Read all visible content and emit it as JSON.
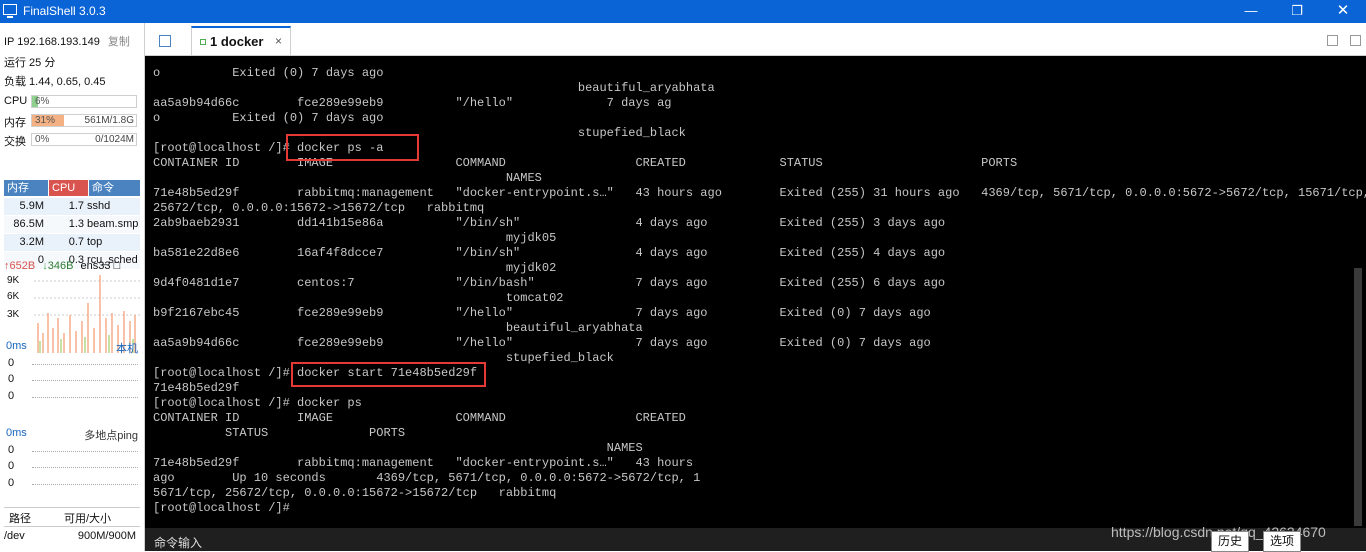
{
  "app": {
    "title": "FinalShell 3.0.3"
  },
  "window": {
    "min_icon": "minimize-icon",
    "max_icon": "restore-icon",
    "close_icon": "close-icon"
  },
  "sidebar": {
    "ip_label": "IP 192.168.193.149",
    "copy_label": "复制",
    "uptime": "运行 25 分",
    "load": "负载 1.44, 0.65, 0.45",
    "cpu": {
      "label": "CPU",
      "pct": "6%",
      "value": 0.06,
      "color": "#8fd08f"
    },
    "mem": {
      "label": "内存",
      "pct": "31%",
      "detail": "561M/1.8G",
      "value": 0.31,
      "color": "#f4b183"
    },
    "swap": {
      "label": "交换",
      "pct": "0%",
      "detail": "0/1024M",
      "value": 0.0
    },
    "proc_headers": {
      "mem": "内存",
      "cpu": "CPU",
      "cmd": "命令"
    },
    "processes": [
      {
        "mem": "5.9M",
        "cpu": "1.7",
        "cmd": "sshd"
      },
      {
        "mem": "86.5M",
        "cpu": "1.3",
        "cmd": "beam.smp"
      },
      {
        "mem": "3.2M",
        "cpu": "0.7",
        "cmd": "top"
      },
      {
        "mem": "0",
        "cpu": "0.3",
        "cmd": "rcu_sched"
      }
    ],
    "net": {
      "up": "652B",
      "down": "346B",
      "iface": "ens33",
      "y_ticks": [
        "9K",
        "6K",
        "3K"
      ]
    },
    "latency": {
      "value": "0ms",
      "target": "本机",
      "rows": [
        "0",
        "0",
        "0"
      ]
    },
    "ping": {
      "value": "0ms",
      "target": "多地点ping",
      "rows": [
        "0",
        "0",
        "0"
      ]
    },
    "fs": {
      "col_path": "路径",
      "col_size": "可用/大小",
      "rows": [
        {
          "path": "/dev",
          "size": "900M/900M"
        }
      ]
    }
  },
  "tabs": {
    "active_label": "1 docker",
    "close": "×"
  },
  "terminal": {
    "lines": [
      "o          Exited (0) 7 days ago",
      "                                                           beautiful_aryabhata",
      "aa5a9b94d66c        fce289e99eb9          \"/hello\"             7 days ag",
      "o          Exited (0) 7 days ago",
      "                                                           stupefied_black",
      "[root@localhost /]# docker ps -a",
      "CONTAINER ID        IMAGE                 COMMAND                  CREATED             STATUS                      PORTS",
      "                                                 NAMES",
      "71e48b5ed29f        rabbitmq:management   \"docker-entrypoint.s…\"   43 hours ago        Exited (255) 31 hours ago   4369/tcp, 5671/tcp, 0.0.0.0:5672->5672/tcp, 15671/tcp,",
      "25672/tcp, 0.0.0.0:15672->15672/tcp   rabbitmq",
      "2ab9baeb2931        dd141b15e86a          \"/bin/sh\"                4 days ago          Exited (255) 3 days ago",
      "                                                 myjdk05",
      "ba581e22d8e6        16af4f8dcce7          \"/bin/sh\"                4 days ago          Exited (255) 4 days ago",
      "                                                 myjdk02",
      "9d4f0481d1e7        centos:7              \"/bin/bash\"              7 days ago          Exited (255) 6 days ago",
      "                                                 tomcat02",
      "b9f2167ebc45        fce289e99eb9          \"/hello\"                 7 days ago          Exited (0) 7 days ago",
      "                                                 beautiful_aryabhata",
      "aa5a9b94d66c        fce289e99eb9          \"/hello\"                 7 days ago          Exited (0) 7 days ago",
      "                                                 stupefied_black",
      "[root@localhost /]# docker start 71e48b5ed29f",
      "71e48b5ed29f",
      "[root@localhost /]# docker ps",
      "CONTAINER ID        IMAGE                 COMMAND                  CREATED",
      "          STATUS              PORTS",
      "                                                               NAMES",
      "71e48b5ed29f        rabbitmq:management   \"docker-entrypoint.s…\"   43 hours",
      "ago        Up 10 seconds       4369/tcp, 5671/tcp, 0.0.0.0:5672->5672/tcp, 1",
      "5671/tcp, 25672/tcp, 0.0.0.0:15672->15672/tcp   rabbitmq",
      "[root@localhost /]#"
    ],
    "highlight_color": "#e53935"
  },
  "command_bar": {
    "label": "命令输入",
    "history_button": "历史",
    "options_button": "选项",
    "watermark": "https://blog.csdn.net/qq_42624670"
  }
}
